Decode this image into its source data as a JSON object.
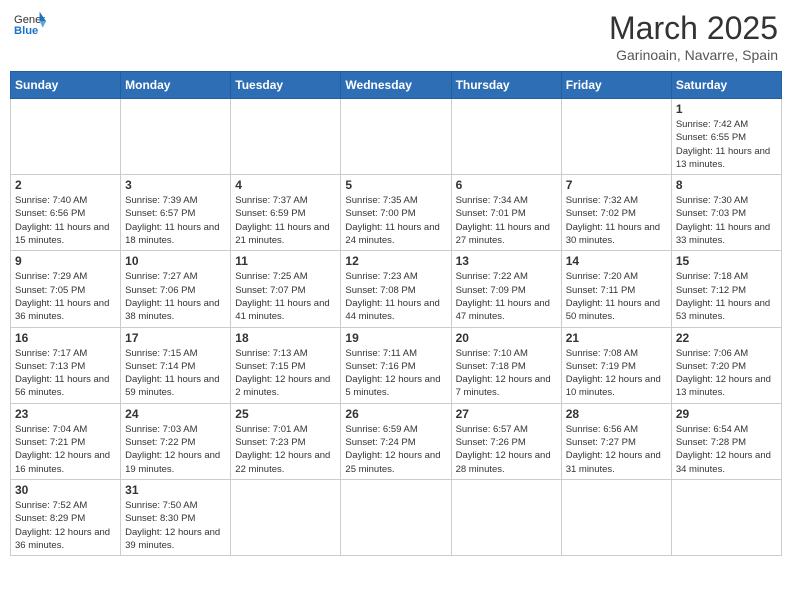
{
  "logo": {
    "text_general": "General",
    "text_blue": "Blue"
  },
  "header": {
    "month": "March 2025",
    "location": "Garinoain, Navarre, Spain"
  },
  "days_of_week": [
    "Sunday",
    "Monday",
    "Tuesday",
    "Wednesday",
    "Thursday",
    "Friday",
    "Saturday"
  ],
  "weeks": [
    [
      {
        "day": "",
        "info": ""
      },
      {
        "day": "",
        "info": ""
      },
      {
        "day": "",
        "info": ""
      },
      {
        "day": "",
        "info": ""
      },
      {
        "day": "",
        "info": ""
      },
      {
        "day": "",
        "info": ""
      },
      {
        "day": "1",
        "info": "Sunrise: 7:42 AM\nSunset: 6:55 PM\nDaylight: 11 hours and 13 minutes."
      }
    ],
    [
      {
        "day": "2",
        "info": "Sunrise: 7:40 AM\nSunset: 6:56 PM\nDaylight: 11 hours and 15 minutes."
      },
      {
        "day": "3",
        "info": "Sunrise: 7:39 AM\nSunset: 6:57 PM\nDaylight: 11 hours and 18 minutes."
      },
      {
        "day": "4",
        "info": "Sunrise: 7:37 AM\nSunset: 6:59 PM\nDaylight: 11 hours and 21 minutes."
      },
      {
        "day": "5",
        "info": "Sunrise: 7:35 AM\nSunset: 7:00 PM\nDaylight: 11 hours and 24 minutes."
      },
      {
        "day": "6",
        "info": "Sunrise: 7:34 AM\nSunset: 7:01 PM\nDaylight: 11 hours and 27 minutes."
      },
      {
        "day": "7",
        "info": "Sunrise: 7:32 AM\nSunset: 7:02 PM\nDaylight: 11 hours and 30 minutes."
      },
      {
        "day": "8",
        "info": "Sunrise: 7:30 AM\nSunset: 7:03 PM\nDaylight: 11 hours and 33 minutes."
      }
    ],
    [
      {
        "day": "9",
        "info": "Sunrise: 7:29 AM\nSunset: 7:05 PM\nDaylight: 11 hours and 36 minutes."
      },
      {
        "day": "10",
        "info": "Sunrise: 7:27 AM\nSunset: 7:06 PM\nDaylight: 11 hours and 38 minutes."
      },
      {
        "day": "11",
        "info": "Sunrise: 7:25 AM\nSunset: 7:07 PM\nDaylight: 11 hours and 41 minutes."
      },
      {
        "day": "12",
        "info": "Sunrise: 7:23 AM\nSunset: 7:08 PM\nDaylight: 11 hours and 44 minutes."
      },
      {
        "day": "13",
        "info": "Sunrise: 7:22 AM\nSunset: 7:09 PM\nDaylight: 11 hours and 47 minutes."
      },
      {
        "day": "14",
        "info": "Sunrise: 7:20 AM\nSunset: 7:11 PM\nDaylight: 11 hours and 50 minutes."
      },
      {
        "day": "15",
        "info": "Sunrise: 7:18 AM\nSunset: 7:12 PM\nDaylight: 11 hours and 53 minutes."
      }
    ],
    [
      {
        "day": "16",
        "info": "Sunrise: 7:17 AM\nSunset: 7:13 PM\nDaylight: 11 hours and 56 minutes."
      },
      {
        "day": "17",
        "info": "Sunrise: 7:15 AM\nSunset: 7:14 PM\nDaylight: 11 hours and 59 minutes."
      },
      {
        "day": "18",
        "info": "Sunrise: 7:13 AM\nSunset: 7:15 PM\nDaylight: 12 hours and 2 minutes."
      },
      {
        "day": "19",
        "info": "Sunrise: 7:11 AM\nSunset: 7:16 PM\nDaylight: 12 hours and 5 minutes."
      },
      {
        "day": "20",
        "info": "Sunrise: 7:10 AM\nSunset: 7:18 PM\nDaylight: 12 hours and 7 minutes."
      },
      {
        "day": "21",
        "info": "Sunrise: 7:08 AM\nSunset: 7:19 PM\nDaylight: 12 hours and 10 minutes."
      },
      {
        "day": "22",
        "info": "Sunrise: 7:06 AM\nSunset: 7:20 PM\nDaylight: 12 hours and 13 minutes."
      }
    ],
    [
      {
        "day": "23",
        "info": "Sunrise: 7:04 AM\nSunset: 7:21 PM\nDaylight: 12 hours and 16 minutes."
      },
      {
        "day": "24",
        "info": "Sunrise: 7:03 AM\nSunset: 7:22 PM\nDaylight: 12 hours and 19 minutes."
      },
      {
        "day": "25",
        "info": "Sunrise: 7:01 AM\nSunset: 7:23 PM\nDaylight: 12 hours and 22 minutes."
      },
      {
        "day": "26",
        "info": "Sunrise: 6:59 AM\nSunset: 7:24 PM\nDaylight: 12 hours and 25 minutes."
      },
      {
        "day": "27",
        "info": "Sunrise: 6:57 AM\nSunset: 7:26 PM\nDaylight: 12 hours and 28 minutes."
      },
      {
        "day": "28",
        "info": "Sunrise: 6:56 AM\nSunset: 7:27 PM\nDaylight: 12 hours and 31 minutes."
      },
      {
        "day": "29",
        "info": "Sunrise: 6:54 AM\nSunset: 7:28 PM\nDaylight: 12 hours and 34 minutes."
      }
    ],
    [
      {
        "day": "30",
        "info": "Sunrise: 7:52 AM\nSunset: 8:29 PM\nDaylight: 12 hours and 36 minutes."
      },
      {
        "day": "31",
        "info": "Sunrise: 7:50 AM\nSunset: 8:30 PM\nDaylight: 12 hours and 39 minutes."
      },
      {
        "day": "",
        "info": ""
      },
      {
        "day": "",
        "info": ""
      },
      {
        "day": "",
        "info": ""
      },
      {
        "day": "",
        "info": ""
      },
      {
        "day": "",
        "info": ""
      }
    ]
  ]
}
